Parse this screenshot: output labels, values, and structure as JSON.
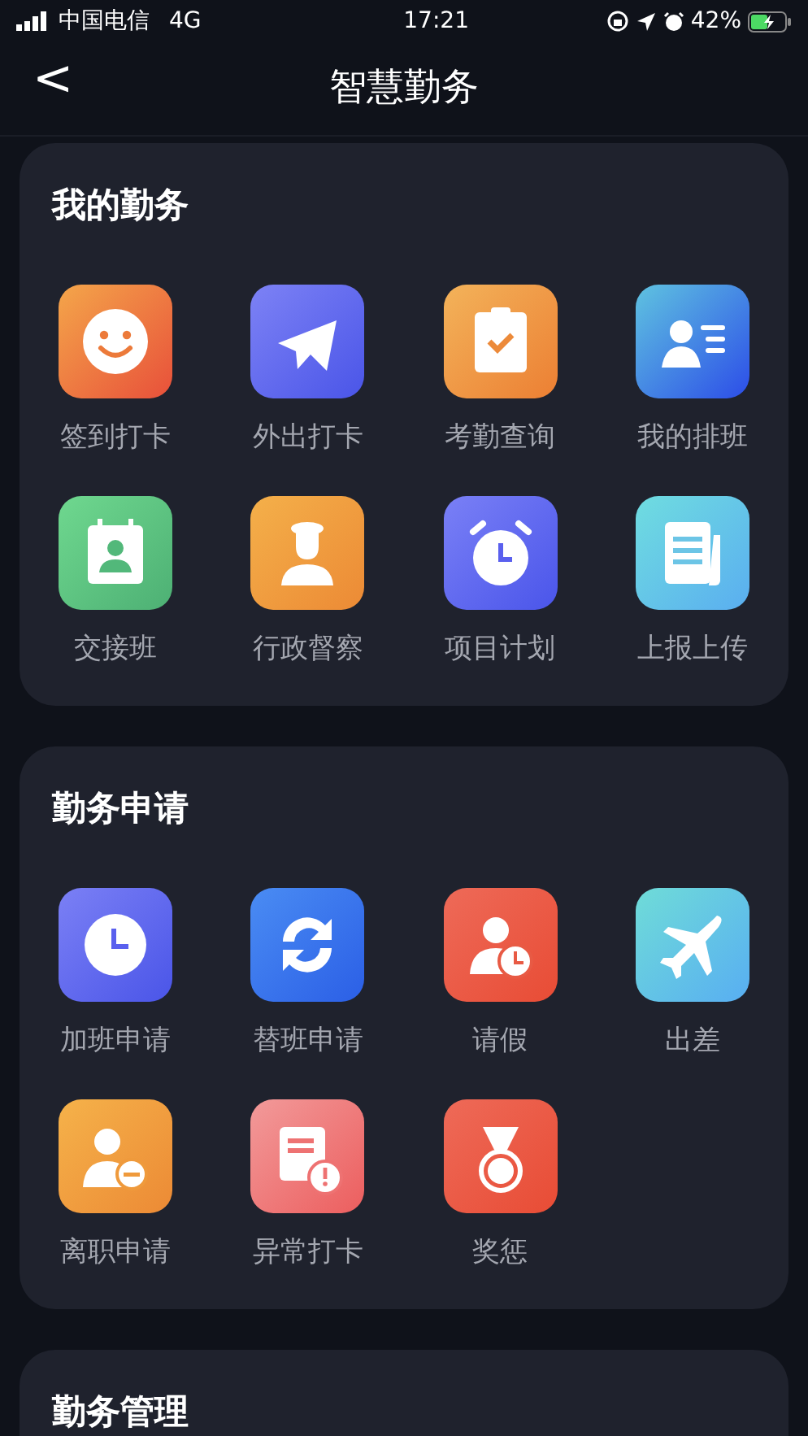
{
  "status_bar": {
    "carrier": "中国电信",
    "network": "4G",
    "time": "17:21",
    "battery": "42%"
  },
  "nav_bar": {
    "back": "<",
    "title": "智慧勤务"
  },
  "sections": [
    {
      "title": "我的勤务",
      "items": [
        {
          "label": "签到打卡"
        },
        {
          "label": "外出打卡"
        },
        {
          "label": "考勤查询"
        },
        {
          "label": "我的排班"
        },
        {
          "label": "交接班"
        },
        {
          "label": "行政督察"
        },
        {
          "label": "项目计划"
        },
        {
          "label": "上报上传"
        }
      ]
    },
    {
      "title": "勤务申请",
      "items": [
        {
          "label": "加班申请"
        },
        {
          "label": "替班申请"
        },
        {
          "label": "请假"
        },
        {
          "label": "出差"
        },
        {
          "label": "离职申请"
        },
        {
          "label": "异常打卡"
        },
        {
          "label": "奖惩"
        }
      ]
    },
    {
      "title": "勤务管理"
    }
  ]
}
